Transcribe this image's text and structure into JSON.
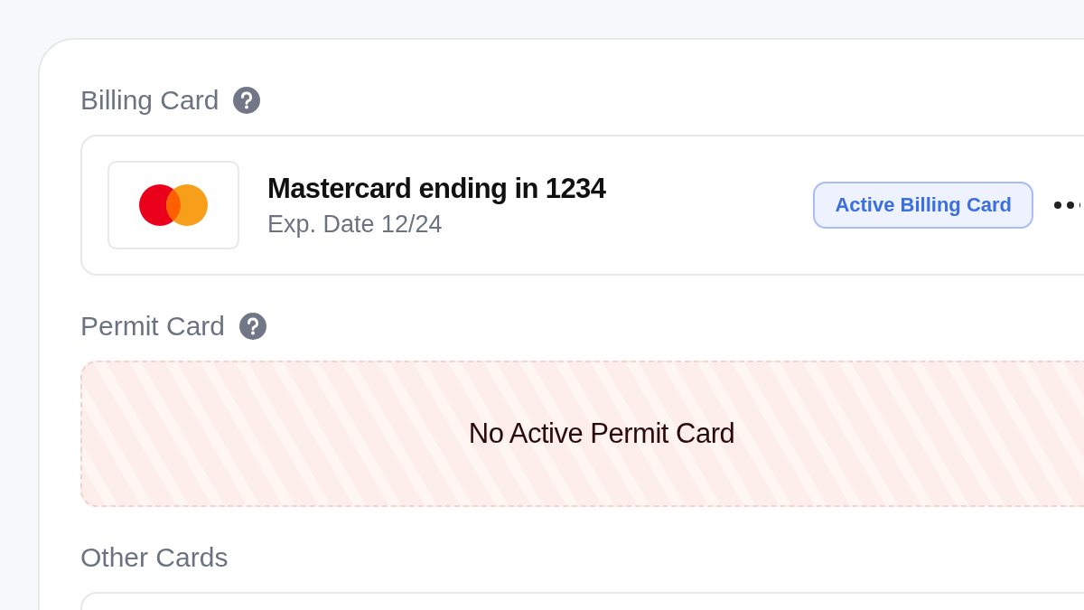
{
  "billing": {
    "title": "Billing Card",
    "has_help": true,
    "card": {
      "name": "Mastercard ending in 1234",
      "expiry": "Exp. Date 12/24",
      "badge": "Active Billing Card"
    }
  },
  "permit": {
    "title": "Permit Card",
    "has_help": true,
    "empty_message": "No Active Permit Card"
  },
  "other": {
    "title": "Other Cards",
    "has_help": false
  }
}
